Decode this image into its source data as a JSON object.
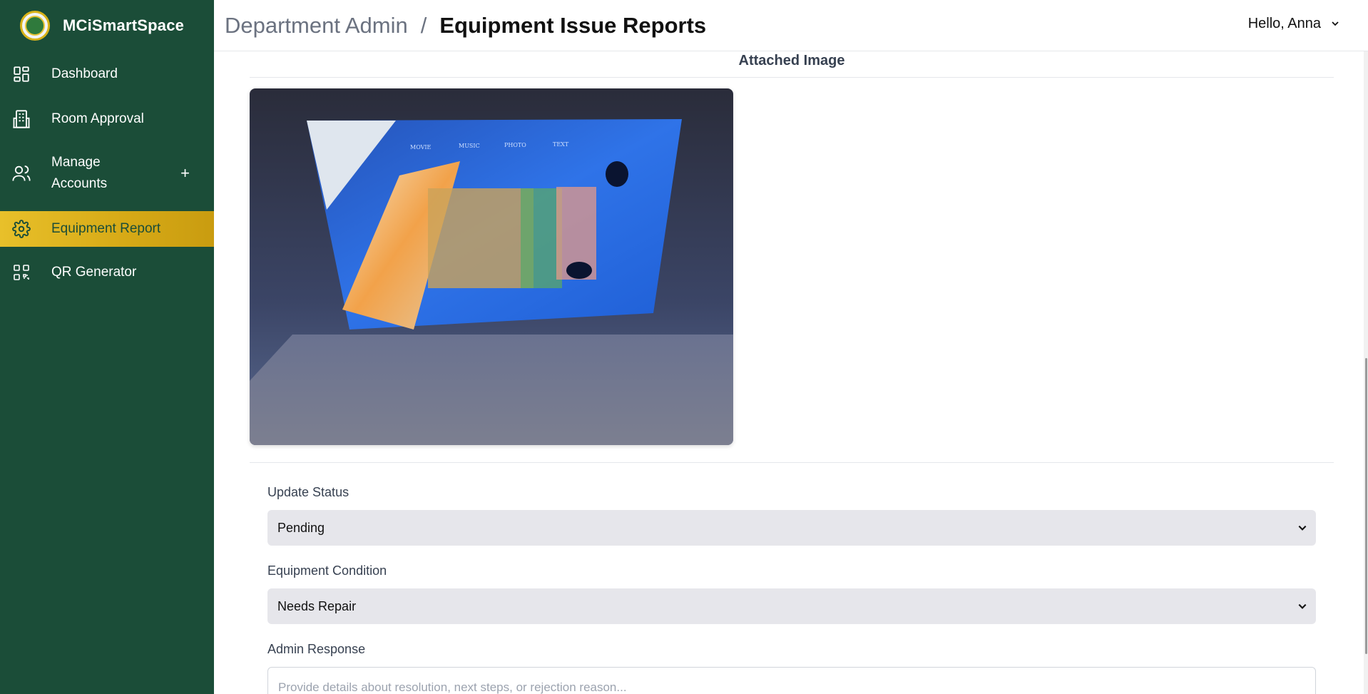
{
  "app": {
    "name": "MCiSmartSpace"
  },
  "sidebar": {
    "items": [
      {
        "label": "Dashboard",
        "icon": "dashboard-icon"
      },
      {
        "label": "Room Approval",
        "icon": "building-icon"
      },
      {
        "label": "Manage Accounts",
        "icon": "users-icon",
        "expandable": true
      },
      {
        "label": "Equipment Report",
        "icon": "gear-icon",
        "active": true
      },
      {
        "label": "QR Generator",
        "icon": "qr-icon"
      }
    ],
    "expand_symbol": "+"
  },
  "header": {
    "parent": "Department Admin",
    "separator": "/",
    "current": "Equipment Issue Reports",
    "user_greeting": "Hello, Anna"
  },
  "report": {
    "attached_image_title": "Attached Image",
    "photo_menu": [
      "MOVIE",
      "MUSIC",
      "PHOTO",
      "TEXT"
    ],
    "status_label": "Update Status",
    "status_value": "Pending",
    "condition_label": "Equipment Condition",
    "condition_value": "Needs Repair",
    "response_label": "Admin Response",
    "response_placeholder": "Provide details about resolution, next steps, or rejection reason..."
  },
  "colors": {
    "sidebar_bg": "#1b4d38",
    "active_gold": "#d6a916",
    "select_bg": "#e6e6eb"
  }
}
